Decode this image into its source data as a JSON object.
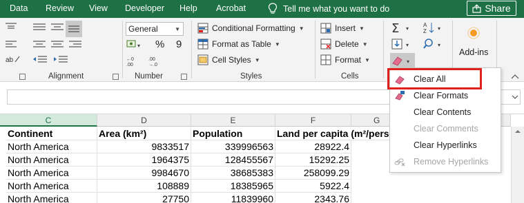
{
  "tabs": [
    "Data",
    "Review",
    "View",
    "Developer",
    "Help",
    "Acrobat"
  ],
  "tell_me": "Tell me what you want to do",
  "share_label": "Share",
  "ribbon": {
    "groups": {
      "alignment": "Alignment",
      "number": "Number",
      "styles": "Styles",
      "cells": "Cells"
    },
    "number_format": "General",
    "percent_symbol": "%",
    "comma_symbol": "9",
    "styles_buttons": {
      "conditional_formatting": "Conditional Formatting",
      "format_as_table": "Format as Table",
      "cell_styles": "Cell Styles"
    },
    "cells_buttons": {
      "insert": "Insert",
      "delete": "Delete",
      "format": "Format"
    },
    "addins_label": "Add-ins"
  },
  "clear_menu": {
    "items": [
      {
        "label": "Clear All",
        "enabled": true,
        "icon": "eraser-icon"
      },
      {
        "label": "Clear Formats",
        "enabled": true,
        "icon": "clear-formats-icon"
      },
      {
        "label": "Clear Contents",
        "enabled": true,
        "icon": ""
      },
      {
        "label": "Clear Comments",
        "enabled": false,
        "icon": ""
      },
      {
        "label": "Clear Hyperlinks",
        "enabled": true,
        "icon": ""
      },
      {
        "label": "Remove Hyperlinks",
        "enabled": false,
        "icon": "remove-hyperlinks-icon"
      }
    ]
  },
  "grid": {
    "column_headers": [
      "C",
      "D",
      "E",
      "F",
      "G"
    ],
    "headers": [
      "Continent",
      "Area (km²)",
      "Population",
      "Land per capita (m²/pers"
    ],
    "rows": [
      [
        "North America",
        "9833517",
        "339996563",
        "28922.4"
      ],
      [
        "North America",
        "1964375",
        "128455567",
        "15292.25"
      ],
      [
        "North America",
        "9984670",
        "38685383",
        "258099.29"
      ],
      [
        "North America",
        "108889",
        "18385965",
        "5922.4"
      ],
      [
        "North America",
        "27750",
        "11839960",
        "2343.76"
      ]
    ]
  },
  "colors": {
    "excel_green": "#1e7145",
    "highlight_red": "#e0201b",
    "eraser_pink": "#e56b8c"
  }
}
